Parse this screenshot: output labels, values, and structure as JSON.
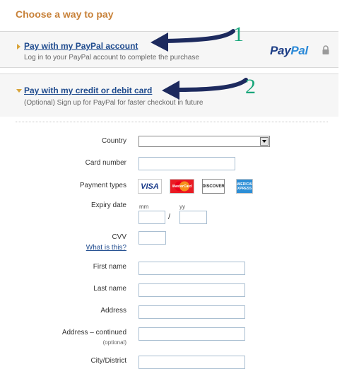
{
  "heading": "Choose a way to pay",
  "option_paypal": {
    "title": "Pay with my PayPal account",
    "subtitle": "Log in to your PayPal account to complete the purchase",
    "logo_part1": "Pay",
    "logo_part2": "Pal"
  },
  "option_card": {
    "title": "Pay with my credit or debit card",
    "subtitle": "(Optional) Sign up for PayPal for faster checkout in future"
  },
  "annotations": {
    "arrow1_number": "1",
    "arrow2_number": "2"
  },
  "form": {
    "country_label": "Country",
    "country_value": "",
    "card_number_label": "Card number",
    "payment_types_label": "Payment types",
    "card_types": {
      "visa": "VISA",
      "mastercard": "MasterCard",
      "discover": "DISCOVER",
      "amex": "AMERICAN EXPRESS"
    },
    "expiry_label": "Expiry date",
    "expiry_mm": "mm",
    "expiry_yy": "yy",
    "expiry_sep": "/",
    "cvv_label": "CVV",
    "cvv_help": "What is this?",
    "first_name_label": "First name",
    "last_name_label": "Last name",
    "address_label": "Address",
    "address2_label": "Address – continued",
    "address2_optional": "(optional)",
    "city_label": "City/District"
  },
  "colors": {
    "heading": "#c8823a",
    "link": "#1f4b8e",
    "triangle": "#d8a43a",
    "annotation_arrow": "#1d2a5e",
    "annotation_number": "#18a67a"
  },
  "icons": {
    "arrow_right": "triangle-right-icon",
    "arrow_down": "triangle-down-icon",
    "lock": "lock-icon",
    "select": "chevron-down-icon"
  }
}
